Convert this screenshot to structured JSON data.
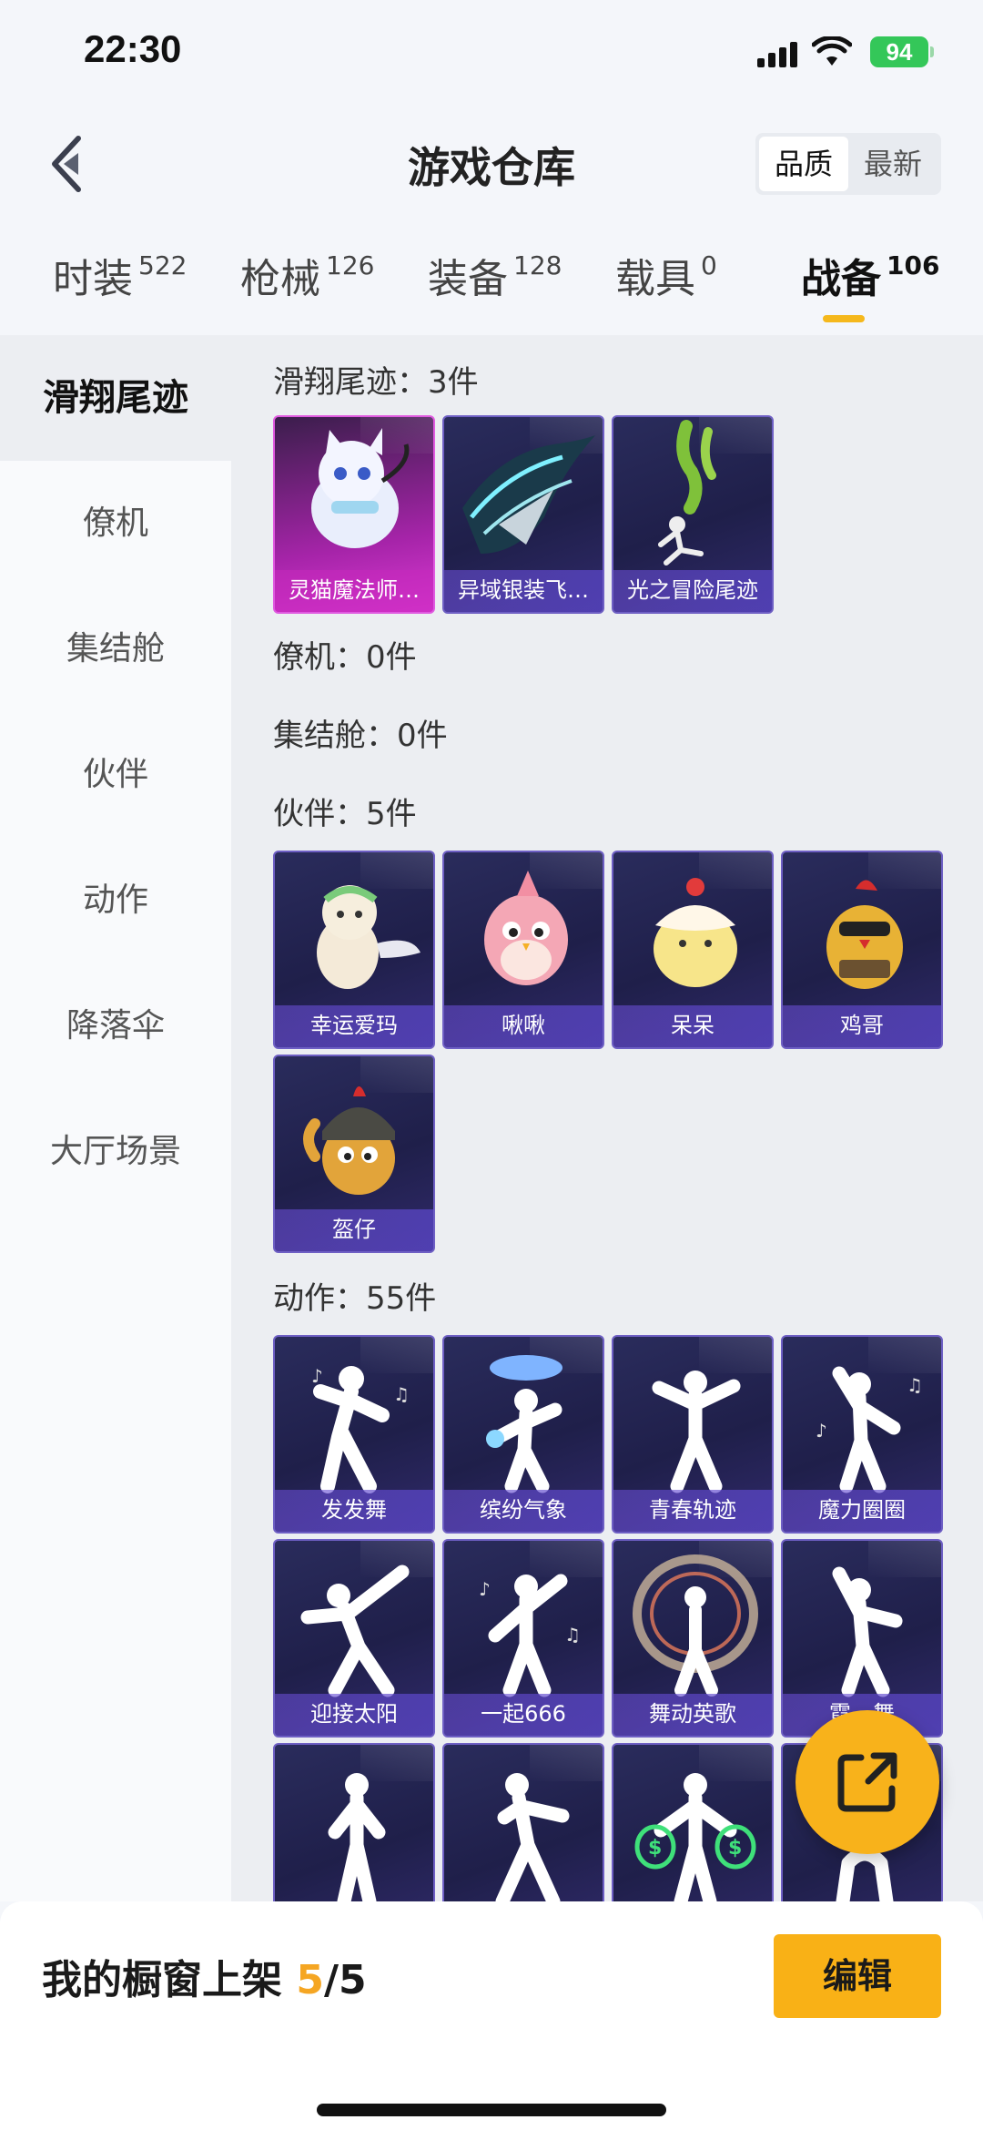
{
  "status": {
    "time": "22:30",
    "battery": "94"
  },
  "header": {
    "title": "游戏仓库",
    "sort_options": [
      "品质",
      "最新"
    ],
    "active_sort": 0
  },
  "tabs": [
    {
      "label": "时装",
      "count": "522"
    },
    {
      "label": "枪械",
      "count": "126"
    },
    {
      "label": "装备",
      "count": "128"
    },
    {
      "label": "载具",
      "count": "0"
    },
    {
      "label": "战备",
      "count": "106"
    }
  ],
  "sidebar": [
    "滑翔尾迹",
    "僚机",
    "集结舱",
    "伙伴",
    "动作",
    "降落伞",
    "大厅场景"
  ],
  "sections": {
    "glide": {
      "title": "滑翔尾迹：3件",
      "items": [
        "灵猫魔法师…",
        "异域银装飞…",
        "光之冒险尾迹"
      ]
    },
    "wingman": {
      "title": "僚机：0件"
    },
    "pod": {
      "title": "集结舱：0件"
    },
    "partner": {
      "title": "伙伴：5件",
      "items": [
        "幸运爱玛",
        "啾啾",
        "呆呆",
        "鸡哥",
        "盔仔"
      ]
    },
    "action": {
      "title": "动作：55件",
      "items": [
        "发发舞",
        "缤纷气象",
        "青春轨迹",
        "魔力圈圈",
        "迎接太阳",
        "一起666",
        "舞动英歌",
        "霓…舞"
      ]
    }
  },
  "bottom": {
    "prefix": "我的橱窗上架 ",
    "count": "5",
    "total": "/5",
    "edit_label": "编辑"
  },
  "colors": {
    "accent": "#f5b81c",
    "card_bg": "#252652",
    "card_pink": "#c02fc0"
  }
}
